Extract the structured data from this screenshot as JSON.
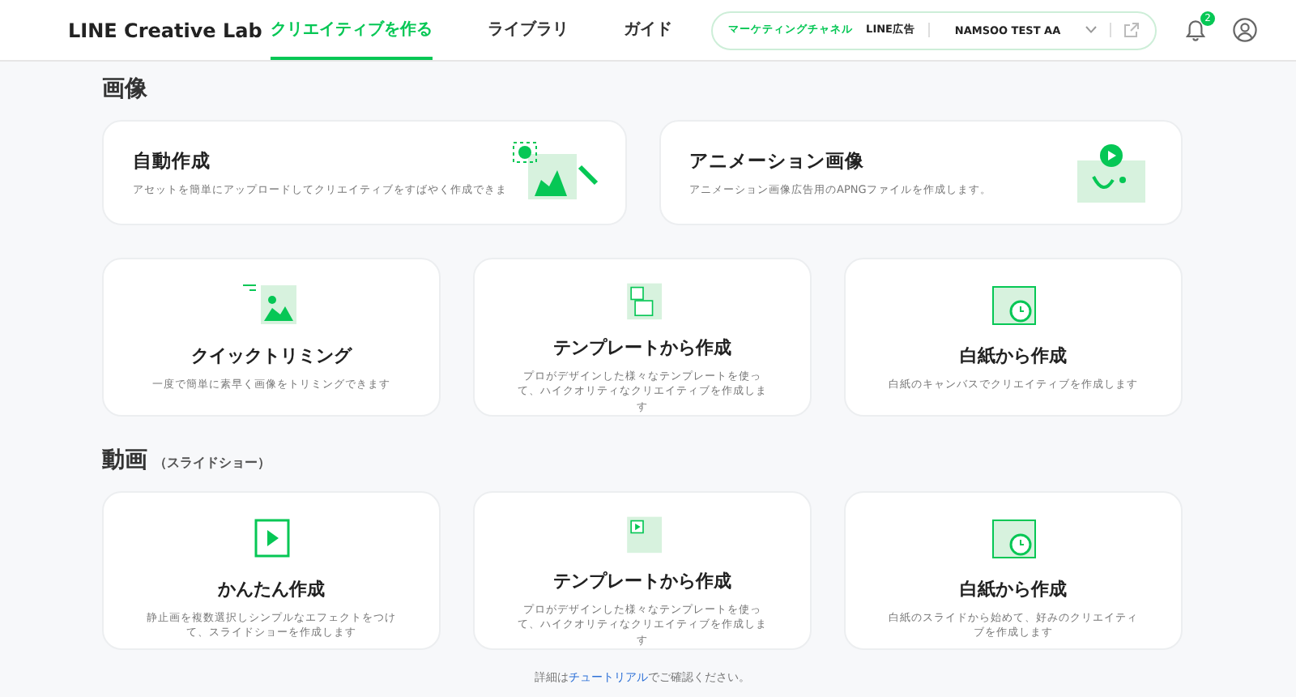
{
  "header": {
    "logo": "LINE Creative Lab",
    "nav": [
      {
        "label": "クリエイティブを作る",
        "selected": true
      },
      {
        "label": "ライブラリ",
        "selected": false
      },
      {
        "label": "ガイド",
        "selected": false
      }
    ],
    "channel": {
      "label": "マーケティングチャネル",
      "platform": "LINE広告",
      "account": "NAMSOO TEST AA"
    },
    "notification_count": "2"
  },
  "sections": [
    {
      "title": "画像",
      "cards": [
        {
          "kind": "wide",
          "title": "自動作成",
          "description": "アセットを簡単にアップロードしてクリエイティブをすばやく作成できま"
        },
        {
          "kind": "wide",
          "title": "アニメーション画像",
          "description": "アニメーション画像広告用のAPNGファイルを作成します。"
        },
        {
          "kind": "tall",
          "title": "クイックトリミング",
          "description": "一度で簡単に素早く画像をトリミングできます"
        },
        {
          "kind": "tall",
          "title": "テンプレートから作成",
          "description": "プロがデザインした様々なテンプレートを使って、ハイクオリティなクリエイティブを作成します"
        },
        {
          "kind": "tall",
          "title": "白紙から作成",
          "description": "白紙のキャンバスでクリエイティブを作成します"
        }
      ]
    },
    {
      "title": "動画",
      "subtitle": "（スライドショー）",
      "cards": [
        {
          "kind": "tall",
          "title": "かんたん作成",
          "description": "静止画を複数選択しシンプルなエフェクトをつけて、スライドショーを作成します"
        },
        {
          "kind": "tall",
          "title": "テンプレートから作成",
          "description": "プロがデザインした様々なテンプレートを使って、ハイクオリティなクリエイティブを作成します"
        },
        {
          "kind": "tall",
          "title": "白紙から作成",
          "description": "白紙のスライドから始めて、好みのクリエイティブを作成します"
        }
      ]
    }
  ],
  "footer": {
    "prefix": "詳細は",
    "link": "チュートリアル",
    "suffix": "でご確認ください。"
  }
}
